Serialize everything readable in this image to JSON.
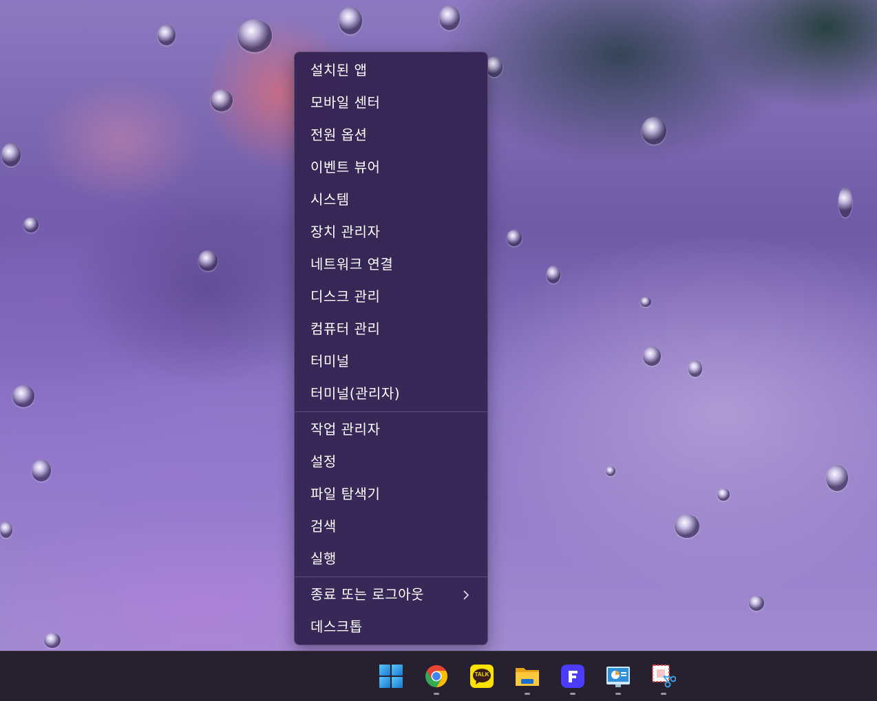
{
  "context_menu": {
    "groups": [
      {
        "items": [
          {
            "label": "설치된 앱"
          },
          {
            "label": "모바일 센터"
          },
          {
            "label": "전원 옵션"
          },
          {
            "label": "이벤트 뷰어"
          },
          {
            "label": "시스템"
          },
          {
            "label": "장치 관리자"
          },
          {
            "label": "네트워크 연결"
          },
          {
            "label": "디스크 관리"
          },
          {
            "label": "컴퓨터 관리"
          },
          {
            "label": "터미널"
          },
          {
            "label": "터미널(관리자)"
          }
        ]
      },
      {
        "items": [
          {
            "label": "작업 관리자"
          },
          {
            "label": "설정"
          },
          {
            "label": "파일 탐색기"
          },
          {
            "label": "검색"
          },
          {
            "label": "실행"
          }
        ]
      },
      {
        "items": [
          {
            "label": "종료 또는 로그아웃",
            "submenu_icon": "chevron-right-icon"
          },
          {
            "label": "데스크톱"
          }
        ]
      }
    ]
  },
  "taskbar": {
    "apps": [
      {
        "name": "start-button",
        "icon": "windows-logo-icon",
        "running": false
      },
      {
        "name": "taskbar-app-chrome",
        "icon": "chrome-icon",
        "running": true
      },
      {
        "name": "taskbar-app-kakaotalk",
        "icon": "kakaotalk-icon",
        "label": "TALK",
        "running": false
      },
      {
        "name": "taskbar-app-file-explorer",
        "icon": "folder-icon",
        "running": true
      },
      {
        "name": "taskbar-app-f",
        "icon": "f-app-icon",
        "running": true
      },
      {
        "name": "taskbar-app-presentation",
        "icon": "presentation-icon",
        "running": true
      },
      {
        "name": "taskbar-app-snipping-tool",
        "icon": "snipping-tool-icon",
        "running": true
      }
    ]
  }
}
